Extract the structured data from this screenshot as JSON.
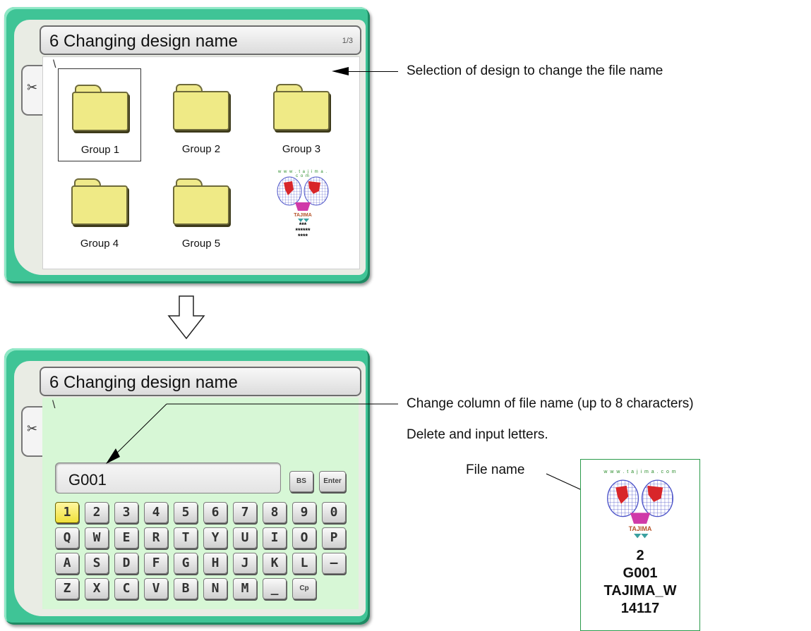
{
  "screen1": {
    "title": "6 Changing design name",
    "page_indicator": "1/3",
    "path": "\\",
    "items": [
      {
        "label": "Group 1",
        "type": "folder",
        "selected": true
      },
      {
        "label": "Group 2",
        "type": "folder"
      },
      {
        "label": "Group 3",
        "type": "folder"
      },
      {
        "label": "Group 4",
        "type": "folder"
      },
      {
        "label": "Group 5",
        "type": "folder"
      },
      {
        "type": "design",
        "url": "w w w . t a j i m a . c o m",
        "logo": "TAJIMA",
        "stars_line1": "***",
        "stars_line2": "******",
        "stars_line3": "****"
      }
    ]
  },
  "screen2": {
    "title": "6 Changing design name",
    "path": "\\",
    "input_value": "G001",
    "bs_label": "BS",
    "enter_label": "Enter",
    "keyboard_rows": [
      [
        "1",
        "2",
        "3",
        "4",
        "5",
        "6",
        "7",
        "8",
        "9",
        "0"
      ],
      [
        "Q",
        "W",
        "E",
        "R",
        "T",
        "Y",
        "U",
        "I",
        "O",
        "P"
      ],
      [
        "A",
        "S",
        "D",
        "F",
        "G",
        "H",
        "J",
        "K",
        "L",
        "—"
      ],
      [
        "Z",
        "X",
        "C",
        "V",
        "B",
        "N",
        "M",
        "_",
        "Cp"
      ]
    ],
    "active_key": "1"
  },
  "annotations": {
    "selection_note": "Selection of design to change the file name",
    "change_column_note": "Change column of file name (up to 8 characters)",
    "delete_input_note": "Delete and input letters.",
    "file_name_label": "File name"
  },
  "file_card": {
    "url": "w w w . t a j i m a . c o m",
    "logo": "TAJIMA",
    "line1": "2",
    "line2": "G001",
    "line3": "TAJIMA_W",
    "line4": "14117"
  },
  "colors": {
    "frame": "#3fc496",
    "folder": "#efea86",
    "keyboard_area": "#d7f7d6",
    "active_key": "#f0e03a"
  },
  "icons": [
    "scissors-icon",
    "folder-icon",
    "down-arrow-icon"
  ]
}
